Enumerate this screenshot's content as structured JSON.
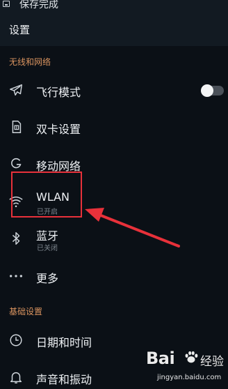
{
  "status_bar": {
    "notification_text": "保存完成"
  },
  "app_bar": {
    "title": "设置"
  },
  "sections": [
    {
      "header": "无线和网络"
    },
    {
      "header": "基础设置"
    }
  ],
  "items": {
    "airplane": {
      "label": "飞行模式",
      "icon": "airplane-icon",
      "toggle_on": false
    },
    "dual_sim": {
      "label": "双卡设置",
      "icon": "sim-card-icon"
    },
    "mobile_network": {
      "label": "移动网络",
      "icon": "g-network-icon"
    },
    "wlan": {
      "label": "WLAN",
      "sub": "已开启",
      "icon": "wifi-icon"
    },
    "bluetooth": {
      "label": "蓝牙",
      "sub": "已关闭",
      "icon": "bluetooth-icon"
    },
    "more": {
      "label": "更多",
      "icon": "more-dots-icon"
    },
    "datetime": {
      "label": "日期和时间",
      "icon": "clock-icon"
    },
    "sound": {
      "label": "声音和振动",
      "icon": "bell-icon"
    }
  },
  "watermark": {
    "brand": "Bai",
    "word": "经验",
    "url": "jingyan.baidu.com"
  },
  "colors": {
    "background": "#0b1016",
    "section_header": "#d9935f",
    "highlight": "#e8313a"
  }
}
